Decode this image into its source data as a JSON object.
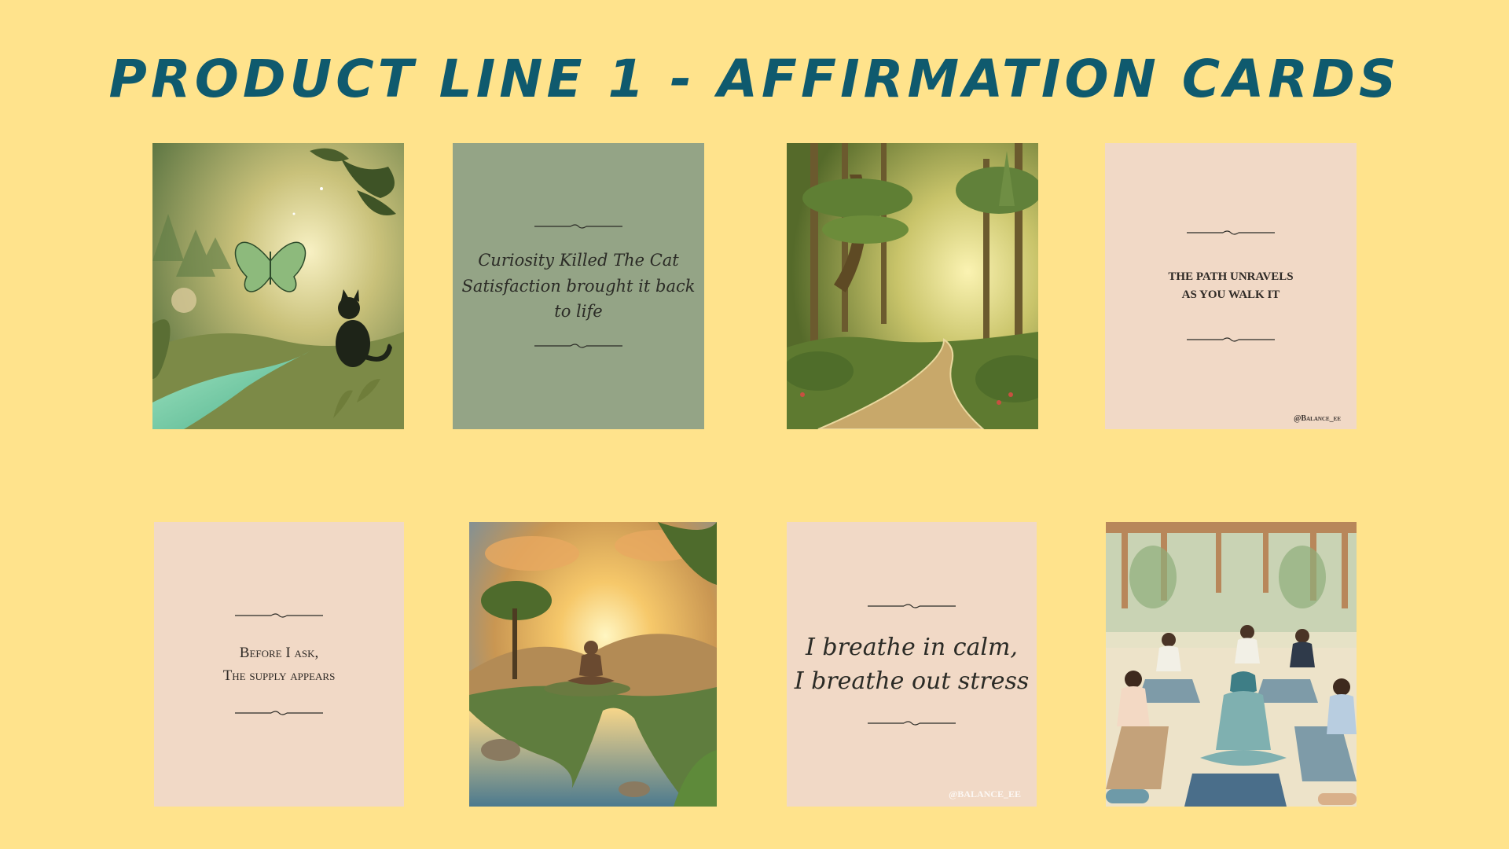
{
  "page": {
    "title": "Product Line 1 - Affirmation Cards",
    "background": "#FFE38C",
    "title_color": "#0F5A6E"
  },
  "cards": [
    {
      "kind": "image",
      "scene": "butterfly-and-cat-by-stream"
    },
    {
      "kind": "text",
      "bg": "#94A486",
      "lines": [
        "Curiosity Killed The Cat",
        "Satisfaction brought it back to life"
      ]
    },
    {
      "kind": "image",
      "scene": "sunlit-forest-path"
    },
    {
      "kind": "text",
      "bg": "#F1D9C6",
      "lines": [
        "The path unravels",
        "as you walk it"
      ],
      "handle": "@Balance_ee"
    },
    {
      "kind": "text",
      "bg": "#F1D9C6",
      "lines": [
        "Before I ask,",
        "The supply appears"
      ]
    },
    {
      "kind": "image",
      "scene": "meditating-figure-at-sunrise-river"
    },
    {
      "kind": "text",
      "bg": "#F1D9C6",
      "lines": [
        "I breathe in calm,",
        "I breathe out stress"
      ],
      "handle": "@BALANCE_EE"
    },
    {
      "kind": "image",
      "scene": "group-yoga-meditation-class"
    }
  ],
  "icons": {
    "divider": "ornamental-divider-icon"
  }
}
